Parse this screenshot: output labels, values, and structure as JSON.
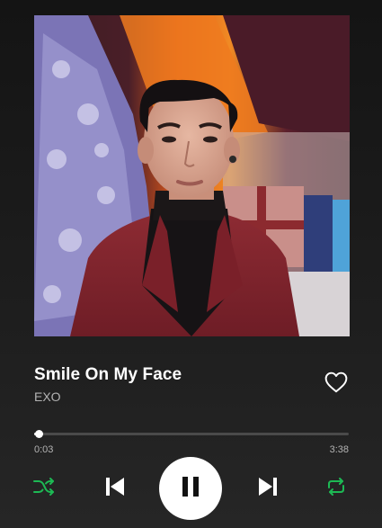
{
  "track": {
    "title": "Smile On My Face",
    "artist": "EXO",
    "liked": false
  },
  "playback": {
    "elapsed": "0:03",
    "duration": "3:38",
    "progress_fraction": 0.014,
    "state": "playing"
  },
  "icons": {
    "like": "heart-outline-icon",
    "shuffle": "shuffle-icon",
    "previous": "skip-previous-icon",
    "pause": "pause-icon",
    "next": "skip-next-icon",
    "repeat": "repeat-icon"
  },
  "colors": {
    "accent": "#1db954",
    "background": "#1d1d1d",
    "secondary_text": "#b3b3b3",
    "progress_track": "#4a4a4a"
  }
}
